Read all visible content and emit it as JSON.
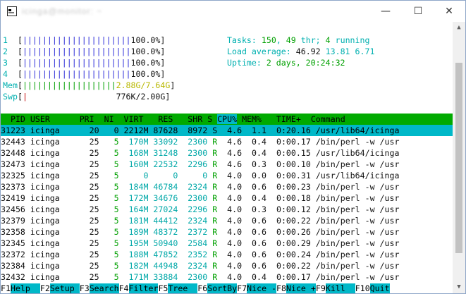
{
  "window": {
    "title": "icinga@monitor: ~",
    "minimize_glyph": "—",
    "maximize_glyph": "☐",
    "close_glyph": "✕"
  },
  "meters": {
    "cpus": [
      {
        "label": "1",
        "bar": "||||||||||||||||||||||",
        "value": "100.0%"
      },
      {
        "label": "2",
        "bar": "||||||||||||||||||||||",
        "value": "100.0%"
      },
      {
        "label": "3",
        "bar": "||||||||||||||||||||||",
        "value": "100.0%"
      },
      {
        "label": "4",
        "bar": "||||||||||||||||||||||",
        "value": "100.0%"
      }
    ],
    "mem": {
      "label": "Mem",
      "bar": "|||||||||||||||||||",
      "value": "2.88G/7.64G"
    },
    "swp": {
      "label": "Swp",
      "bar": "|",
      "value": "776K/2.00G"
    }
  },
  "summary": {
    "tasks_label": "Tasks: ",
    "tasks": "150",
    "sep1": ", ",
    "thr": "49",
    "thr_label": " thr; ",
    "running": "4",
    "running_label": " running",
    "load_label": "Load average: ",
    "load1": "46.92",
    "load5": "13.81",
    "load15": "6.71",
    "uptime_label": "Uptime: ",
    "uptime": "2 days, 20:24:32"
  },
  "table": {
    "columns": [
      "  PID",
      "USER",
      "      PRI",
      "  NI",
      "  VIRT",
      "   RES",
      "   SHR",
      "S",
      "CPU%",
      "MEM%",
      "   TIME+",
      "  Command"
    ],
    "rows": [
      {
        "pid": "31223",
        "user": "icinga",
        "pri": "20",
        "ni": "0",
        "virt": "2212M",
        "res": "87628",
        "shr": "8972",
        "s": "S",
        "cpu": "4.6",
        "mem": "1.1",
        "time": "0:20.16",
        "cmd": "/usr/lib64/icinga",
        "selected": true
      },
      {
        "pid": "32443",
        "user": "icinga",
        "pri": "25",
        "ni": "5",
        "virt": "170M",
        "res": "33092",
        "shr": "2300",
        "s": "R",
        "cpu": "4.6",
        "mem": "0.4",
        "time": "0:00.17",
        "cmd": "/bin/perl -w /usr"
      },
      {
        "pid": "32448",
        "user": "icinga",
        "pri": "25",
        "ni": "5",
        "virt": "168M",
        "res": "31248",
        "shr": "2300",
        "s": "R",
        "cpu": "4.6",
        "mem": "0.4",
        "time": "0:00.15",
        "cmd": "/usr/lib64/icinga"
      },
      {
        "pid": "32473",
        "user": "icinga",
        "pri": "25",
        "ni": "5",
        "virt": "160M",
        "res": "22532",
        "shr": "2296",
        "s": "R",
        "cpu": "4.6",
        "mem": "0.3",
        "time": "0:00.10",
        "cmd": "/bin/perl -w /usr"
      },
      {
        "pid": "32325",
        "user": "icinga",
        "pri": "25",
        "ni": "5",
        "virt": "0",
        "res": "0",
        "shr": "0",
        "s": "R",
        "cpu": "4.0",
        "mem": "0.0",
        "time": "0:00.31",
        "cmd": "/usr/lib64/icinga"
      },
      {
        "pid": "32373",
        "user": "icinga",
        "pri": "25",
        "ni": "5",
        "virt": "184M",
        "res": "46784",
        "shr": "2324",
        "s": "R",
        "cpu": "4.0",
        "mem": "0.6",
        "time": "0:00.23",
        "cmd": "/bin/perl -w /usr"
      },
      {
        "pid": "32419",
        "user": "icinga",
        "pri": "25",
        "ni": "5",
        "virt": "172M",
        "res": "34676",
        "shr": "2300",
        "s": "R",
        "cpu": "4.0",
        "mem": "0.4",
        "time": "0:00.18",
        "cmd": "/bin/perl -w /usr"
      },
      {
        "pid": "32456",
        "user": "icinga",
        "pri": "25",
        "ni": "5",
        "virt": "164M",
        "res": "27024",
        "shr": "2296",
        "s": "R",
        "cpu": "4.0",
        "mem": "0.3",
        "time": "0:00.12",
        "cmd": "/bin/perl -w /usr"
      },
      {
        "pid": "32379",
        "user": "icinga",
        "pri": "25",
        "ni": "5",
        "virt": "181M",
        "res": "44412",
        "shr": "2324",
        "s": "R",
        "cpu": "4.0",
        "mem": "0.6",
        "time": "0:00.22",
        "cmd": "/bin/perl -w /usr"
      },
      {
        "pid": "32358",
        "user": "icinga",
        "pri": "25",
        "ni": "5",
        "virt": "189M",
        "res": "48372",
        "shr": "2372",
        "s": "R",
        "cpu": "4.0",
        "mem": "0.6",
        "time": "0:00.26",
        "cmd": "/bin/perl -w /usr"
      },
      {
        "pid": "32345",
        "user": "icinga",
        "pri": "25",
        "ni": "5",
        "virt": "195M",
        "res": "50940",
        "shr": "2584",
        "s": "R",
        "cpu": "4.0",
        "mem": "0.6",
        "time": "0:00.29",
        "cmd": "/bin/perl -w /usr"
      },
      {
        "pid": "32372",
        "user": "icinga",
        "pri": "25",
        "ni": "5",
        "virt": "188M",
        "res": "47852",
        "shr": "2352",
        "s": "R",
        "cpu": "4.0",
        "mem": "0.6",
        "time": "0:00.24",
        "cmd": "/bin/perl -w /usr"
      },
      {
        "pid": "32384",
        "user": "icinga",
        "pri": "25",
        "ni": "5",
        "virt": "182M",
        "res": "44948",
        "shr": "2324",
        "s": "R",
        "cpu": "4.0",
        "mem": "0.6",
        "time": "0:00.22",
        "cmd": "/bin/perl -w /usr"
      },
      {
        "pid": "32432",
        "user": "icinga",
        "pri": "25",
        "ni": "5",
        "virt": "171M",
        "res": "33884",
        "shr": "2300",
        "s": "R",
        "cpu": "4.0",
        "mem": "0.4",
        "time": "0:00.17",
        "cmd": "/bin/perl -w /usr"
      }
    ]
  },
  "fkeys": [
    {
      "key": "F1",
      "label": "Help  "
    },
    {
      "key": "F2",
      "label": "Setup "
    },
    {
      "key": "F3",
      "label": "Search"
    },
    {
      "key": "F4",
      "label": "Filter"
    },
    {
      "key": "F5",
      "label": "Tree  "
    },
    {
      "key": "F6",
      "label": "SortBy"
    },
    {
      "key": "F7",
      "label": "Nice -"
    },
    {
      "key": "F8",
      "label": "Nice +"
    },
    {
      "key": "F9",
      "label": "Kill  "
    },
    {
      "key": "F10",
      "label": "Quit"
    }
  ],
  "colors": {
    "header_bg": "#00aa00",
    "selected_bg": "#00b8c8",
    "fkey_label_bg": "#00b8c8"
  }
}
